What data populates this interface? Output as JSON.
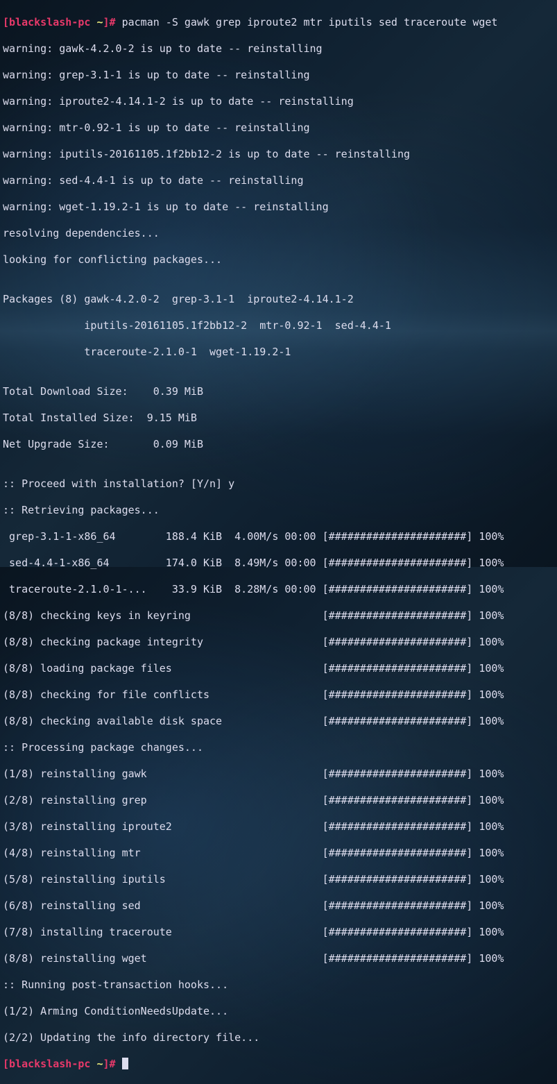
{
  "prompt": {
    "open": "[",
    "user_host": "blackslash-pc",
    "path": " ~",
    "close": "]",
    "hash": "# "
  },
  "command": "pacman -S gawk grep iproute2 mtr iputils sed traceroute wget",
  "warnings": [
    "warning: gawk-4.2.0-2 is up to date -- reinstalling",
    "warning: grep-3.1-1 is up to date -- reinstalling",
    "warning: iproute2-4.14.1-2 is up to date -- reinstalling",
    "warning: mtr-0.92-1 is up to date -- reinstalling",
    "warning: iputils-20161105.1f2bb12-2 is up to date -- reinstalling",
    "warning: sed-4.4-1 is up to date -- reinstalling",
    "warning: wget-1.19.2-1 is up to date -- reinstalling"
  ],
  "resolving": "resolving dependencies...",
  "looking": "looking for conflicting packages...",
  "blank1": "",
  "packages_lines": [
    "Packages (8) gawk-4.2.0-2  grep-3.1-1  iproute2-4.14.1-2",
    "             iputils-20161105.1f2bb12-2  mtr-0.92-1  sed-4.4-1",
    "             traceroute-2.1.0-1  wget-1.19.2-1"
  ],
  "blank2": "",
  "sizes": [
    "Total Download Size:    0.39 MiB",
    "Total Installed Size:  9.15 MiB",
    "Net Upgrade Size:       0.09 MiB"
  ],
  "blank3": "",
  "proceed": ":: Proceed with installation? [Y/n] y",
  "retrieving": ":: Retrieving packages...",
  "downloads": [
    " grep-3.1-1-x86_64        188.4 KiB  4.00M/s 00:00 [######################] 100%",
    " sed-4.4-1-x86_64         174.0 KiB  8.49M/s 00:00 [######################] 100%",
    " traceroute-2.1.0-1-...    33.9 KiB  8.28M/s 00:00 [######################] 100%"
  ],
  "checks": [
    "(8/8) checking keys in keyring                     [######################] 100%",
    "(8/8) checking package integrity                   [######################] 100%",
    "(8/8) loading package files                        [######################] 100%",
    "(8/8) checking for file conflicts                  [######################] 100%",
    "(8/8) checking available disk space                [######################] 100%"
  ],
  "processing": ":: Processing package changes...",
  "installs": [
    "(1/8) reinstalling gawk                            [######################] 100%",
    "(2/8) reinstalling grep                            [######################] 100%",
    "(3/8) reinstalling iproute2                        [######################] 100%",
    "(4/8) reinstalling mtr                             [######################] 100%",
    "(5/8) reinstalling iputils                         [######################] 100%",
    "(6/8) reinstalling sed                             [######################] 100%",
    "(7/8) installing traceroute                        [######################] 100%",
    "(8/8) reinstalling wget                            [######################] 100%"
  ],
  "hooks_header": ":: Running post-transaction hooks...",
  "hooks": [
    "(1/2) Arming ConditionNeedsUpdate...",
    "(2/2) Updating the info directory file..."
  ]
}
